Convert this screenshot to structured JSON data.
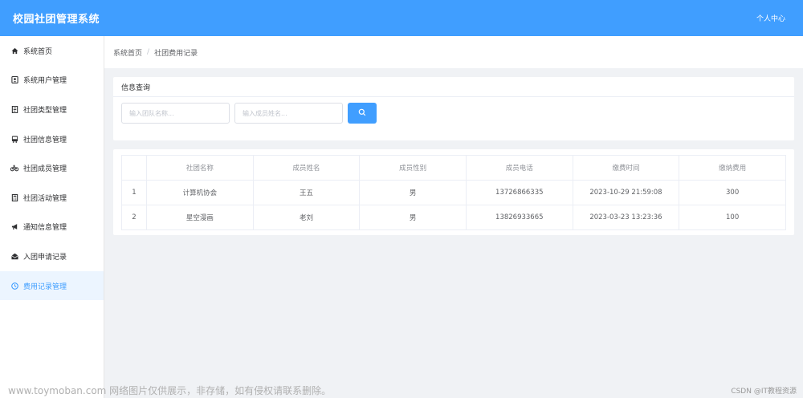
{
  "header": {
    "title": "校园社团管理系统",
    "user_center": "个人中心"
  },
  "sidebar": {
    "items": [
      {
        "label": "系统首页",
        "icon": "home-icon"
      },
      {
        "label": "系统用户管理",
        "icon": "user-card-icon"
      },
      {
        "label": "社团类型管理",
        "icon": "document-icon"
      },
      {
        "label": "社团信息管理",
        "icon": "bus-icon"
      },
      {
        "label": "社团成员管理",
        "icon": "bike-icon"
      },
      {
        "label": "社团活动管理",
        "icon": "calculator-icon"
      },
      {
        "label": "通知信息管理",
        "icon": "megaphone-icon"
      },
      {
        "label": "入团申请记录",
        "icon": "envelope-open-icon"
      },
      {
        "label": "费用记录管理",
        "icon": "clock-icon",
        "active": true
      }
    ]
  },
  "breadcrumb": {
    "home": "系统首页",
    "separator": "/",
    "current": "社团费用记录"
  },
  "search": {
    "title": "信息查询",
    "team_placeholder": "输入团队名称...",
    "member_placeholder": "输入成员姓名..."
  },
  "table": {
    "headers": [
      "",
      "社团名称",
      "成员姓名",
      "成员性别",
      "成员电话",
      "缴费时间",
      "缴纳费用"
    ],
    "rows": [
      [
        "1",
        "计算机协会",
        "王五",
        "男",
        "13726866335",
        "2023-10-29 21:59:08",
        "300"
      ],
      [
        "2",
        "星空漫画",
        "老刘",
        "男",
        "13826933665",
        "2023-03-23 13:23:36",
        "100"
      ]
    ]
  },
  "watermark": "www.toymoban.com 网络图片仅供展示，非存储，如有侵权请联系删除。",
  "credit": "CSDN @IT教程资源",
  "colors": {
    "primary": "#409eff",
    "active_bg": "#ecf5ff",
    "page_bg": "#f0f2f5"
  }
}
